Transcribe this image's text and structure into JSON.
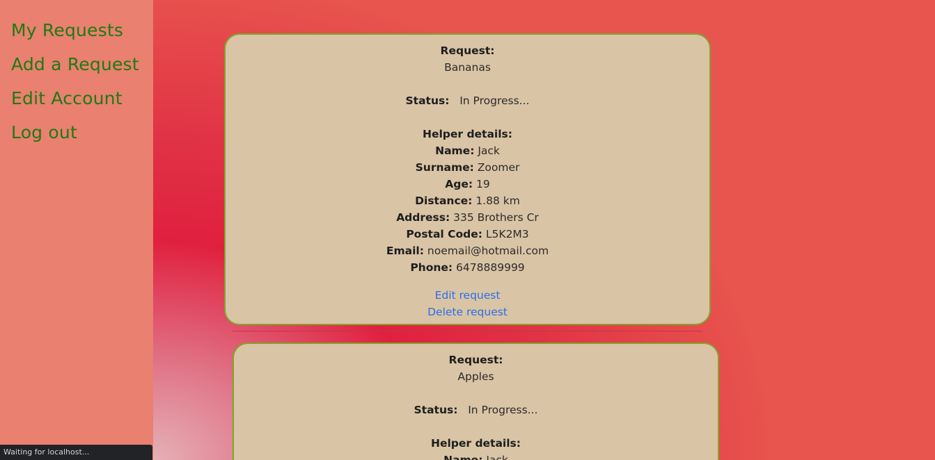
{
  "sidebar": {
    "items": [
      {
        "label": "My Requests"
      },
      {
        "label": "Add a Request"
      },
      {
        "label": "Edit Account"
      },
      {
        "label": "Log out"
      }
    ]
  },
  "status_bar": {
    "text": "Waiting for localhost..."
  },
  "labels": {
    "request": "Request:",
    "status": "Status:",
    "helper_details": "Helper details:",
    "name": "Name:",
    "surname": "Surname:",
    "age": "Age:",
    "distance": "Distance:",
    "address": "Address:",
    "postal_code": "Postal Code:",
    "email": "Email:",
    "phone": "Phone:"
  },
  "requests": [
    {
      "item": "Bananas",
      "status": "In Progress...",
      "helper": {
        "name": "Jack",
        "surname": "Zoomer",
        "age": "19",
        "distance": "1.88 km",
        "address": "335 Brothers Cr",
        "postal_code": "L5K2M3",
        "email": "noemail@hotmail.com",
        "phone": "6478889999"
      },
      "edit_label": "Edit request",
      "delete_label": "Delete request"
    },
    {
      "item": "Apples",
      "status": "In Progress...",
      "helper": {
        "name": "Jack"
      }
    }
  ]
}
